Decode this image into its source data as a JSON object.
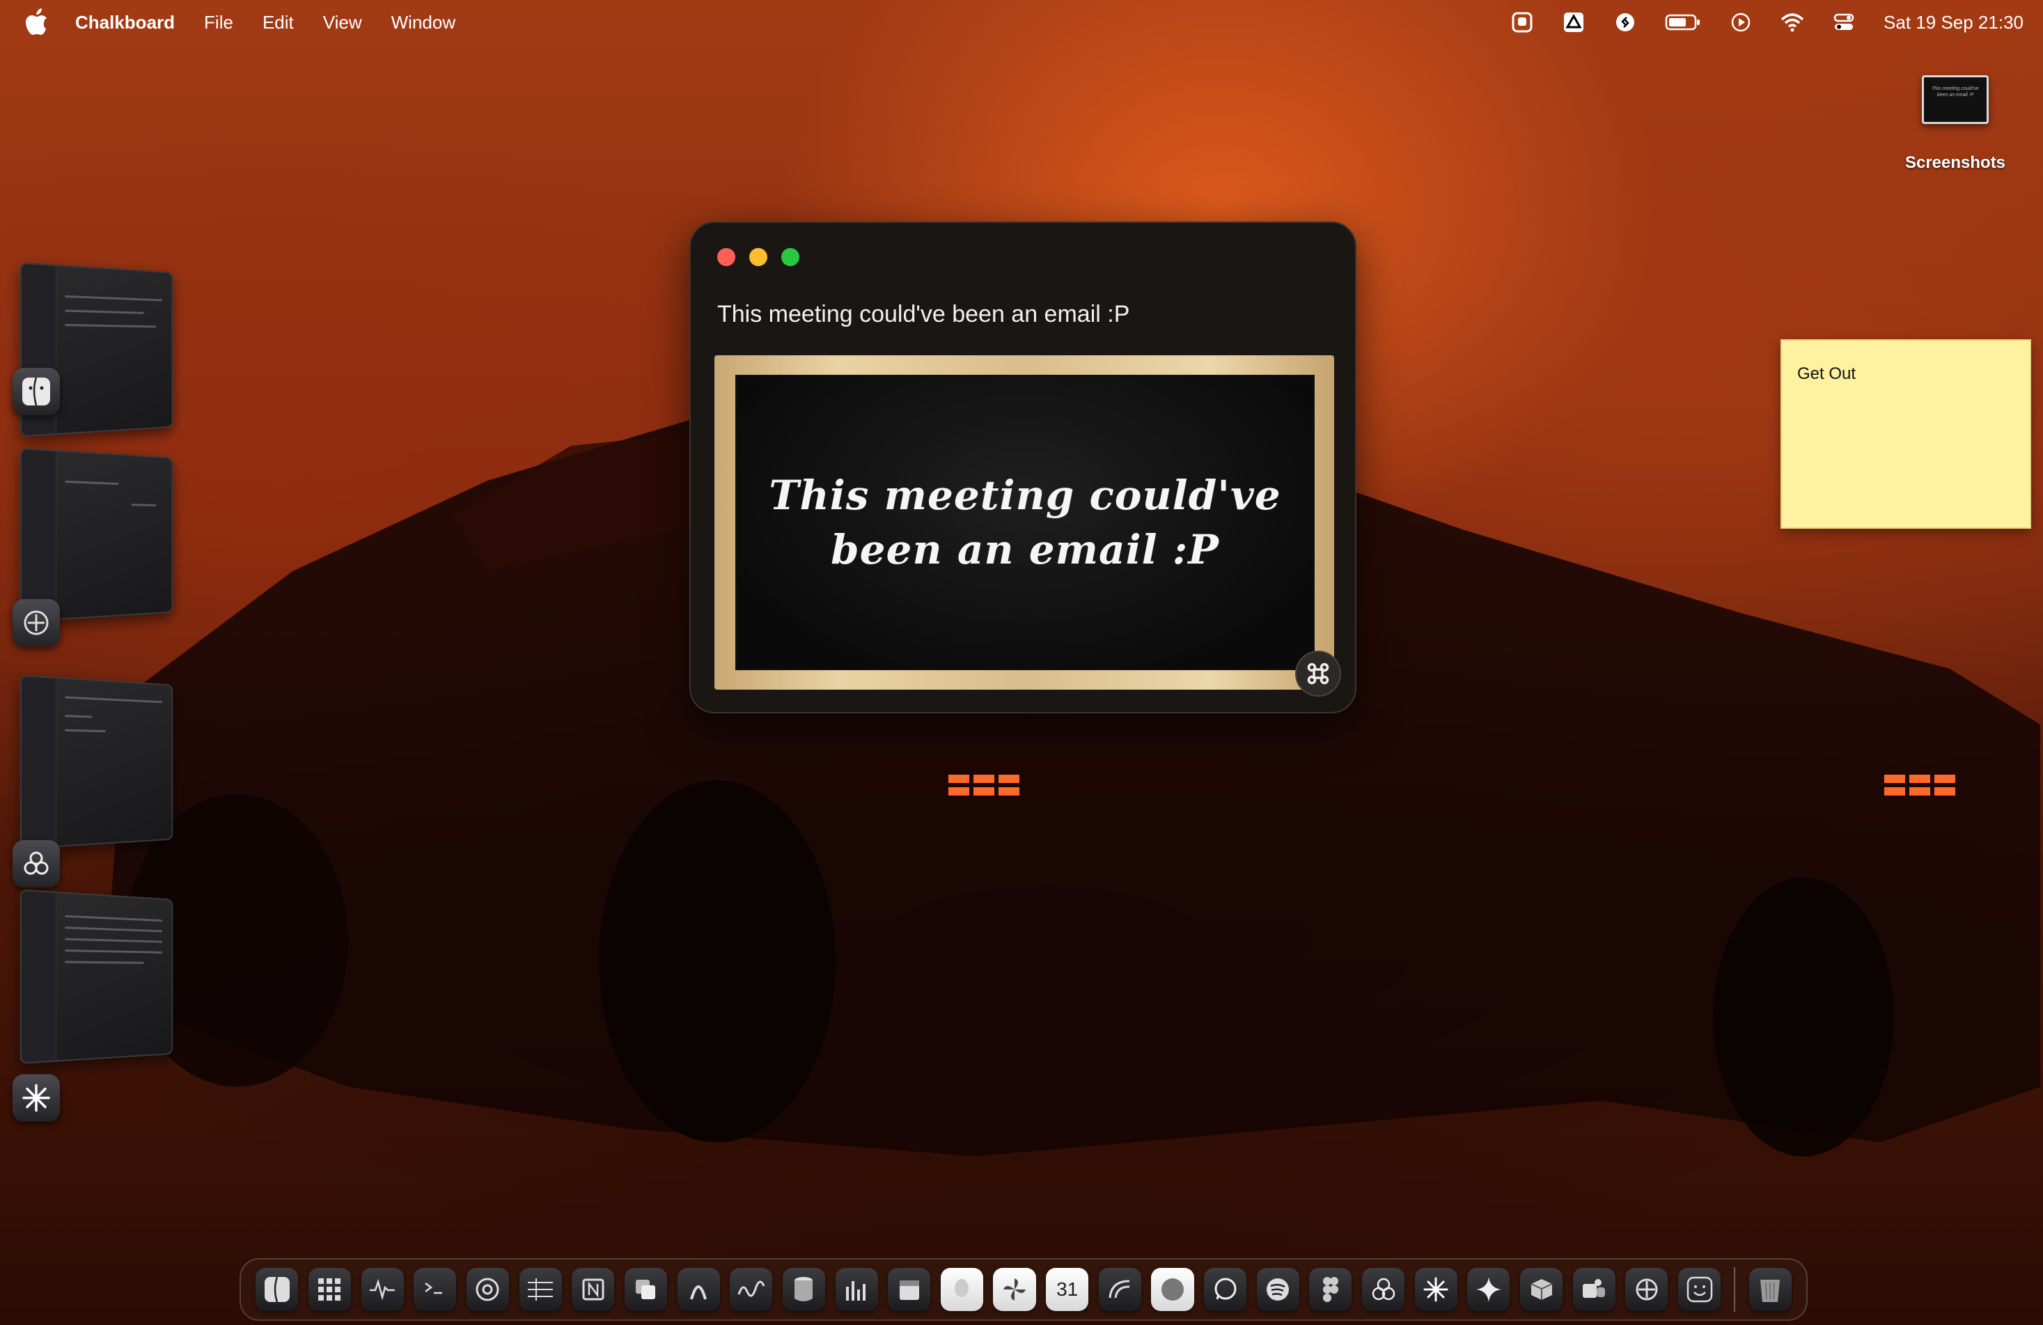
{
  "menubar": {
    "app_name": "Chalkboard",
    "menus": [
      "File",
      "Edit",
      "View",
      "Window"
    ],
    "clock": "Sat 19 Sep  21:30",
    "status_icons": [
      "photo-booth-icon",
      "drive-icon",
      "shazam-icon",
      "battery-icon",
      "play-icon",
      "wifi-icon",
      "control-center-icon"
    ]
  },
  "desktop": {
    "screenshot_label": "Screenshots",
    "screenshot_thumb_text": "This meeting could've been an email :P"
  },
  "sticky": {
    "text": "Get Out"
  },
  "window": {
    "title": "This meeting could've been an email :P",
    "board_text": "This meeting could've been an email :P"
  },
  "stage_manager": {
    "apps": [
      "finder-icon",
      "ai-app-icon",
      "chatgpt-icon",
      "claude-icon"
    ]
  },
  "dock": {
    "apps": [
      "finder-icon",
      "launchpad-icon",
      "activity-monitor-icon",
      "terminal-icon",
      "system-settings-icon",
      "numbers-icon",
      "notion-icon",
      "copy-app-icon",
      "arc-icon",
      "freeform-icon",
      "database-icon",
      "stats-icon",
      "calendar-widget-icon",
      "face-app-icon",
      "pinwheel-icon",
      "calendar-icon",
      "wave-icon",
      "safari-icon",
      "whatsapp-icon",
      "spotify-icon",
      "figma-icon",
      "chatgpt-icon",
      "claude-icon",
      "gemini-icon",
      "box-icon",
      "teams-icon",
      "ai-app-icon",
      "smile-icon",
      "trash-icon"
    ],
    "calendar_day": "31"
  }
}
